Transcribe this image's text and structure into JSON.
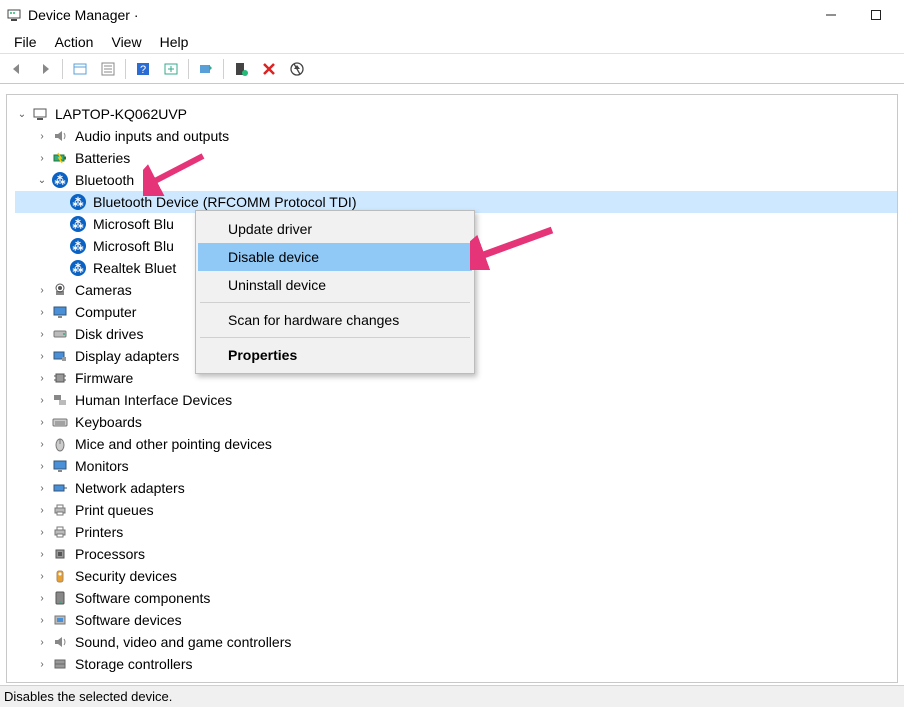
{
  "window": {
    "title": "Device Manager ·"
  },
  "menu": {
    "file": "File",
    "action": "Action",
    "view": "View",
    "help": "Help"
  },
  "tree": {
    "root": "LAPTOP-KQ062UVP",
    "audio": "Audio inputs and outputs",
    "batteries": "Batteries",
    "bluetooth": "Bluetooth",
    "bt_children": {
      "c0": "Bluetooth Device (RFCOMM Protocol TDI)",
      "c1": "Microsoft Blu",
      "c2": "Microsoft Blu",
      "c3": "Realtek Bluet"
    },
    "cameras": "Cameras",
    "computer": "Computer",
    "diskdrives": "Disk drives",
    "displayadapters": "Display adapters",
    "firmware": "Firmware",
    "hid": "Human Interface Devices",
    "keyboards": "Keyboards",
    "mice": "Mice and other pointing devices",
    "monitors": "Monitors",
    "network": "Network adapters",
    "printqueues": "Print queues",
    "printers": "Printers",
    "processors": "Processors",
    "security": "Security devices",
    "softcomp": "Software components",
    "softdev": "Software devices",
    "sound": "Sound, video and game controllers",
    "storage": "Storage controllers"
  },
  "context_menu": {
    "update": "Update driver",
    "disable": "Disable device",
    "uninstall": "Uninstall device",
    "scan": "Scan for hardware changes",
    "properties": "Properties"
  },
  "statusbar": {
    "text": "Disables the selected device."
  },
  "colors": {
    "selection": "#cde8ff",
    "menu_highlight": "#90c8f6",
    "arrow": "#e63478"
  }
}
